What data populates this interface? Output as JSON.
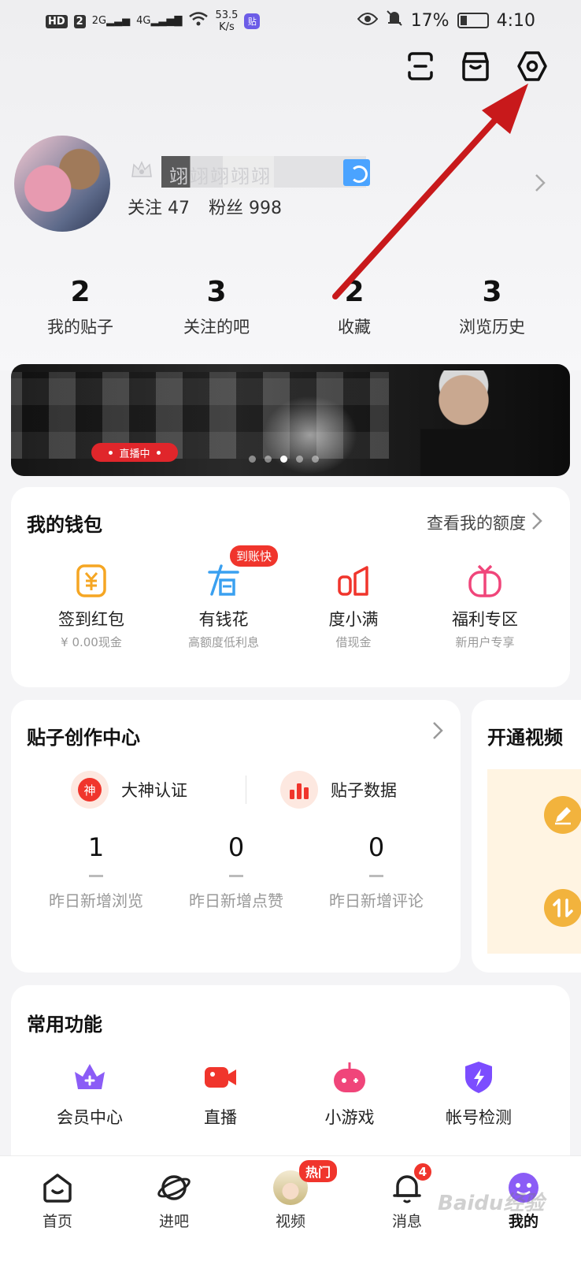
{
  "status_bar": {
    "hd": "HD",
    "sim": "2",
    "net1": "2G",
    "net2": "4G",
    "speed_value": "53.5",
    "speed_unit": "K/s",
    "app_badge": "贴",
    "battery": "17%",
    "time": "4:10"
  },
  "profile": {
    "username": "翊翊翊翊翊",
    "follow_label": "关注",
    "follow_count": "47",
    "fans_label": "粉丝",
    "fans_count": "998"
  },
  "stats": [
    {
      "num": "2",
      "label": "我的贴子"
    },
    {
      "num": "3",
      "label": "关注的吧"
    },
    {
      "num": "2",
      "label": "收藏"
    },
    {
      "num": "3",
      "label": "浏览历史"
    }
  ],
  "banner": {
    "live_label": "直播中",
    "dots": 5,
    "active_dot": 3
  },
  "wallet": {
    "title": "我的钱包",
    "link": "查看我的额度",
    "badge": "到账快",
    "items": [
      {
        "title": "签到红包",
        "sub": "¥ 0.00现金",
        "icon": "yuan-icon",
        "color": "#f5a623"
      },
      {
        "title": "有钱花",
        "sub": "高额度低利息",
        "icon": "youqianhua-icon",
        "color": "#3aa0f0"
      },
      {
        "title": "度小满",
        "sub": "借现金",
        "icon": "duxiaoman-icon",
        "color": "#f0352c"
      },
      {
        "title": "福利专区",
        "sub": "新用户专享",
        "icon": "gift-icon",
        "color": "#f0457a"
      }
    ]
  },
  "creator": {
    "title": "贴子创作中心",
    "btn1": "大神认证",
    "btn1_icon": "神",
    "btn2": "贴子数据",
    "metrics": [
      {
        "value": "1",
        "label": "昨日新增浏览"
      },
      {
        "value": "0",
        "label": "昨日新增点赞"
      },
      {
        "value": "0",
        "label": "昨日新增评论"
      }
    ]
  },
  "video_card": {
    "title": "开通视频"
  },
  "common": {
    "title": "常用功能",
    "items": [
      {
        "label": "会员中心",
        "icon": "vip-crown-icon",
        "color": "#8b5cf6"
      },
      {
        "label": "直播",
        "icon": "video-camera-icon",
        "color": "#f0352c"
      },
      {
        "label": "小游戏",
        "icon": "game-icon",
        "color": "#f0457a"
      },
      {
        "label": "帐号检测",
        "icon": "shield-bolt-icon",
        "color": "#7c4dff"
      }
    ]
  },
  "bottom_nav": {
    "items": [
      {
        "label": "首页"
      },
      {
        "label": "进吧"
      },
      {
        "label": "视频"
      },
      {
        "label": "消息"
      },
      {
        "label": "我的"
      }
    ],
    "hot_badge": "热门",
    "message_count": "4"
  },
  "watermark": "Baidu经验",
  "colors": {
    "accent_red": "#f0352c",
    "annotation_arrow": "#c8191b"
  }
}
